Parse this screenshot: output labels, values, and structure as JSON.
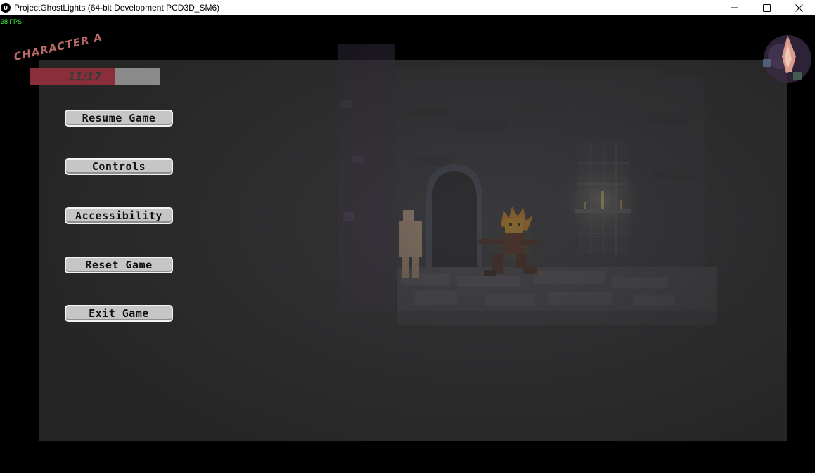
{
  "window": {
    "title": "ProjectGhostLights (64-bit Development PCD3D_SM6)",
    "icon": "unreal-engine-icon",
    "controls": {
      "minimize": "minimize-icon",
      "maximize": "maximize-icon",
      "close": "close-icon"
    }
  },
  "hud": {
    "fps": "38 FPS",
    "character_name": "CHARACTER A",
    "health_text": "11/17",
    "health_current": 11,
    "health_max": 17
  },
  "pause_menu": {
    "buttons": [
      {
        "label": "Resume Game"
      },
      {
        "label": "Controls"
      },
      {
        "label": "Accessibility"
      },
      {
        "label": "Reset Game"
      },
      {
        "label": "Exit Game"
      }
    ]
  },
  "colors": {
    "fps_text": "#3cff3c",
    "health_fill": "#8a2e3a",
    "health_bg": "#8a8a8a",
    "button_bg": "#c6c6c6",
    "overlay": "#3c3c3c"
  }
}
